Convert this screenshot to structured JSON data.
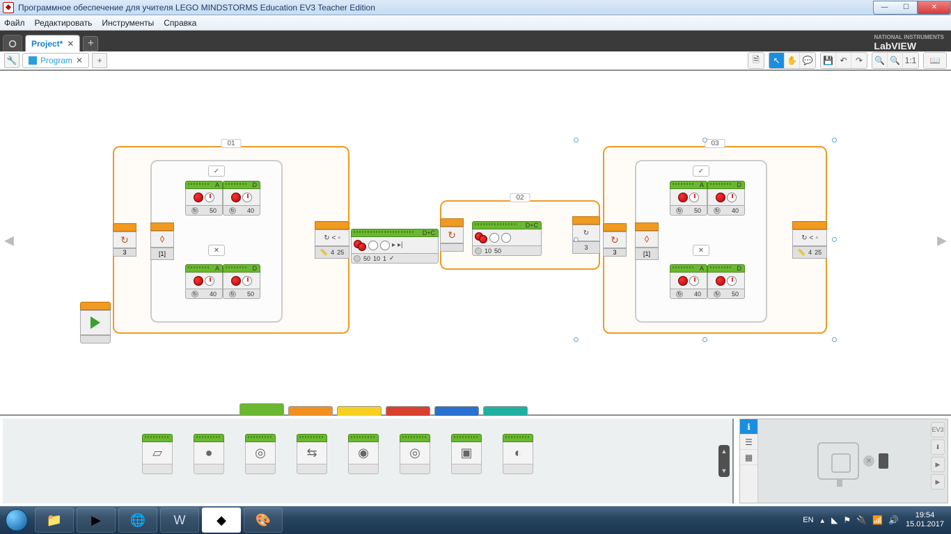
{
  "window": {
    "title": "Программное обеспечение для учителя LEGO MINDSTORMS Education EV3 Teacher Edition"
  },
  "menu": {
    "file": "Файл",
    "edit": "Редактировать",
    "tools": "Инструменты",
    "help": "Справка"
  },
  "brand": {
    "name": "LabVIEW",
    "sub": "NATIONAL INSTRUMENTS"
  },
  "project_tab": {
    "name": "Project*"
  },
  "program_tab": {
    "name": "Program"
  },
  "toolbar": {
    "ratio": "1:1"
  },
  "loops": {
    "l1": {
      "label": "01",
      "count": "3",
      "end_n": "4",
      "end_v": "25",
      "end_sym": "<"
    },
    "l2": {
      "label": "02",
      "count": "3"
    },
    "l3": {
      "label": "03",
      "count": "3",
      "end_n": "4",
      "end_v": "25",
      "end_sym": "<"
    }
  },
  "switch1": {
    "port": "[1]",
    "true": {
      "motorA": {
        "port": "A",
        "val": "50"
      },
      "motorD": {
        "port": "D",
        "val": "40"
      }
    },
    "false": {
      "motorA": {
        "port": "A",
        "val": "40"
      },
      "motorD": {
        "port": "D",
        "val": "50"
      }
    },
    "true_mark": "✓",
    "false_mark": "✕"
  },
  "switch3": {
    "port": "[1]",
    "true": {
      "motorA": {
        "port": "A",
        "val": "50"
      },
      "motorD": {
        "port": "D",
        "val": "40"
      }
    },
    "false": {
      "motorA": {
        "port": "A",
        "val": "40"
      },
      "motorD": {
        "port": "D",
        "val": "50"
      }
    },
    "true_mark": "✓",
    "false_mark": "✕"
  },
  "tank1": {
    "ports": "D+C",
    "p1": "50",
    "p2": "10",
    "p3": "1",
    "chk": "✓"
  },
  "tank2": {
    "ports": "D+C",
    "p1": "10",
    "p2": "50"
  },
  "palette": {
    "blocks": [
      "▱",
      "●",
      "◎",
      "⇆",
      "◉",
      "◎",
      "▣",
      "◐"
    ]
  },
  "hw_side": {
    "ev3": "EV3",
    "play": "▶",
    "dl": "⬇",
    "stop": "▶"
  },
  "tray": {
    "lang": "EN",
    "time": "19:54",
    "date": "15.01.2017"
  }
}
